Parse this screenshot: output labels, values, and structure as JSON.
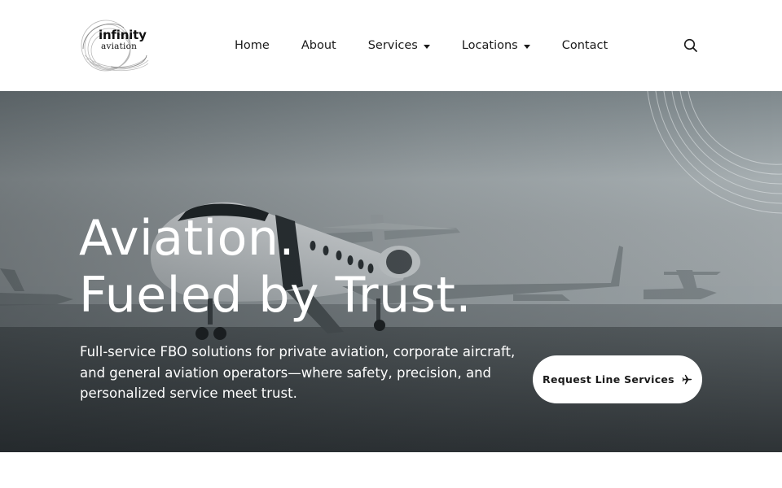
{
  "brand": {
    "line1": "infinity",
    "line2": "aviation",
    "logo_icon": "swirl-ring-logo"
  },
  "nav": {
    "items": [
      {
        "label": "Home",
        "dropdown": false
      },
      {
        "label": "About",
        "dropdown": false
      },
      {
        "label": "Services",
        "dropdown": true
      },
      {
        "label": "Locations",
        "dropdown": true
      },
      {
        "label": "Contact",
        "dropdown": false
      }
    ],
    "search_icon": "search-icon"
  },
  "hero": {
    "title_line1": "Aviation.",
    "title_line2": "Fueled by Trust.",
    "subtitle": "Full-service FBO solutions for private aviation, corporate aircraft, and general aviation operators—where safety, precision, and personalized service meet trust.",
    "cta_label": "Request Line Services",
    "cta_icon": "airplane-icon",
    "background": "private-jet-on-foggy-tarmac"
  },
  "colors": {
    "header_bg": "#ffffff",
    "text_dark": "#1a1a1a",
    "hero_text": "#ffffff",
    "button_bg": "#ffffff"
  }
}
